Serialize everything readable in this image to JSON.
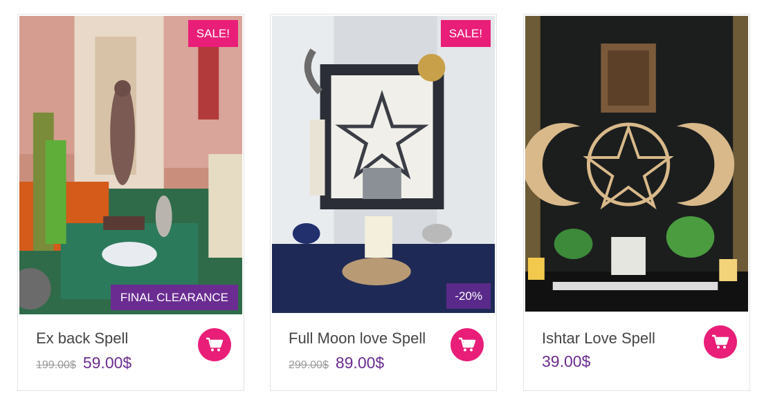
{
  "products": [
    {
      "title": "Ex back Spell",
      "old_price": "199.00$",
      "price": "59.00$",
      "badge_top": "SALE!",
      "badge_bottom": "FINAL CLEARANCE"
    },
    {
      "title": "Full Moon love Spell",
      "old_price": "299.00$",
      "price": "89.00$",
      "badge_top": "SALE!",
      "badge_bottom": "-20%"
    },
    {
      "title": "Ishtar Love Spell",
      "price": "39.00$"
    }
  ],
  "colors": {
    "accent_pink": "#e91e79",
    "accent_purple": "#6a2c91"
  },
  "icons": {
    "cart": "cart-icon"
  }
}
